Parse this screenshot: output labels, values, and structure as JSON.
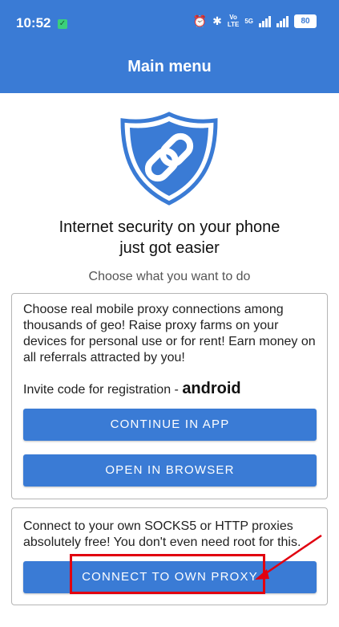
{
  "status_bar": {
    "time": "10:52",
    "volte_label_top": "Vo",
    "volte_label_bottom": "LTE",
    "network_label": "5G",
    "battery": "80"
  },
  "app_bar": {
    "title": "Main menu"
  },
  "hero": {
    "headline_line1": "Internet security on your phone",
    "headline_line2": "just got easier",
    "subtitle": "Choose what you want to do"
  },
  "card1": {
    "description": "Choose real mobile proxy connections among thousands of geo! Raise proxy farms on your devices for personal use or for rent! Earn money on all referrals attracted by you!",
    "invite_prefix": "Invite code for registration - ",
    "invite_code": "android",
    "continue_button": "CONTINUE IN APP",
    "browser_button": "OPEN IN BROWSER"
  },
  "card2": {
    "description": "Connect to your own SOCKS5 or HTTP proxies absolutely free! You don't even need root for this.",
    "proxy_button": "CONNECT TO OWN PROXY"
  },
  "colors": {
    "accent": "#3a7bd5",
    "annotation": "#e1000f"
  }
}
